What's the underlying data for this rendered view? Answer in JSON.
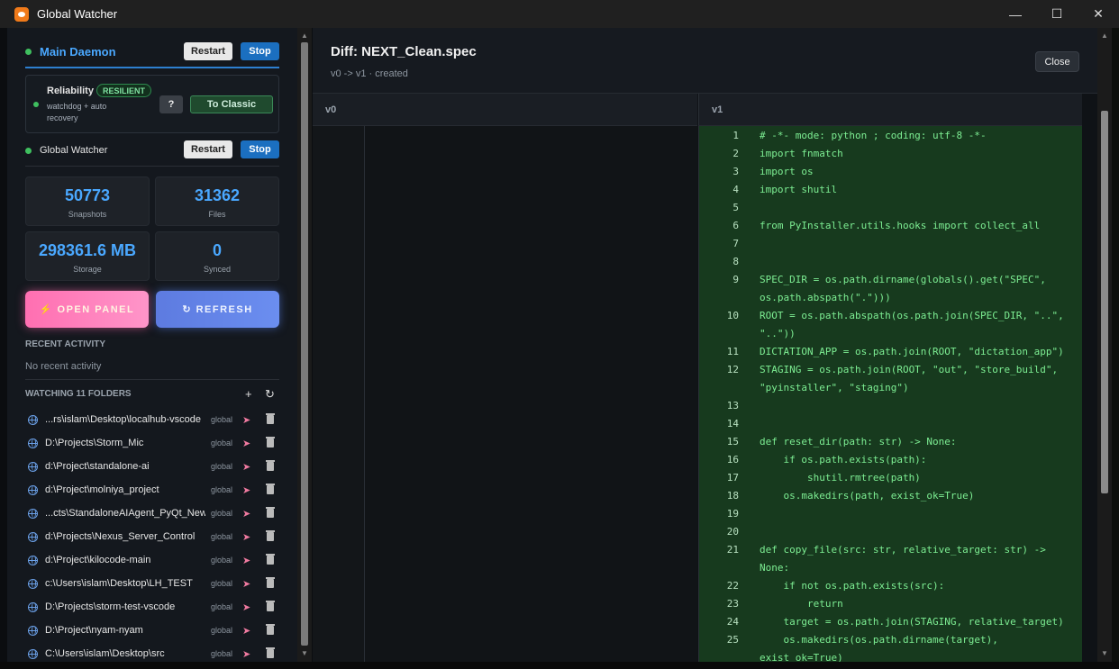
{
  "window": {
    "title": "Global Watcher"
  },
  "daemon": {
    "name": "Main Daemon",
    "restart_label": "Restart",
    "stop_label": "Stop"
  },
  "reliability": {
    "label": "Reliability",
    "badge": "RESILIENT",
    "desc": "watchdog + auto recovery",
    "help_label": "?",
    "classic_label": "To Classic"
  },
  "watcher": {
    "name": "Global Watcher",
    "restart_label": "Restart",
    "stop_label": "Stop"
  },
  "stats": [
    {
      "value": "50773",
      "label": "Snapshots"
    },
    {
      "value": "31362",
      "label": "Files"
    },
    {
      "value": "298361.6 MB",
      "label": "Storage"
    },
    {
      "value": "0",
      "label": "Synced"
    }
  ],
  "actions": {
    "open_panel": "⚡ OPEN PANEL",
    "refresh": "↻ REFRESH"
  },
  "recent": {
    "title": "RECENT ACTIVITY",
    "empty": "No recent activity"
  },
  "folders": {
    "title": "WATCHING 11 FOLDERS",
    "add_icon": "+",
    "refresh_icon": "↻",
    "items": [
      {
        "path": "...rs\\islam\\Desktop\\localhub-vscode",
        "scope": "global"
      },
      {
        "path": "D:\\Projects\\Storm_Mic",
        "scope": "global"
      },
      {
        "path": "d:\\Project\\standalone-ai",
        "scope": "global"
      },
      {
        "path": "d:\\Project\\molniya_project",
        "scope": "global"
      },
      {
        "path": "...cts\\StandaloneAIAgent_PyQt_New",
        "scope": "global"
      },
      {
        "path": "d:\\Projects\\Nexus_Server_Control",
        "scope": "global"
      },
      {
        "path": "d:\\Project\\kilocode-main",
        "scope": "global"
      },
      {
        "path": "c:\\Users\\islam\\Desktop\\LH_TEST",
        "scope": "global"
      },
      {
        "path": "D:\\Projects\\storm-test-vscode",
        "scope": "global"
      },
      {
        "path": "D:\\Project\\nyam-nyam",
        "scope": "global"
      },
      {
        "path": "C:\\Users\\islam\\Desktop\\src",
        "scope": "global"
      }
    ]
  },
  "diff": {
    "title": "Diff: NEXT_Clean.spec",
    "subtitle": "v0 -> v1 · created",
    "close_label": "Close",
    "left_header": "v0",
    "right_header": "v1",
    "lines": [
      {
        "n": "1",
        "text": "# -*- mode: python ; coding: utf-8 -*-"
      },
      {
        "n": "2",
        "text": "import fnmatch"
      },
      {
        "n": "3",
        "text": "import os"
      },
      {
        "n": "4",
        "text": "import shutil"
      },
      {
        "n": "5",
        "text": ""
      },
      {
        "n": "6",
        "text": "from PyInstaller.utils.hooks import collect_all"
      },
      {
        "n": "7",
        "text": ""
      },
      {
        "n": "8",
        "text": ""
      },
      {
        "n": "9",
        "text": "SPEC_DIR = os.path.dirname(globals().get(\"SPEC\","
      },
      {
        "n": "",
        "text": "os.path.abspath(\".\")))"
      },
      {
        "n": "10",
        "text": "ROOT = os.path.abspath(os.path.join(SPEC_DIR, \"..\","
      },
      {
        "n": "",
        "text": "\"..\"))"
      },
      {
        "n": "11",
        "text": "DICTATION_APP = os.path.join(ROOT, \"dictation_app\")"
      },
      {
        "n": "12",
        "text": "STAGING = os.path.join(ROOT, \"out\", \"store_build\","
      },
      {
        "n": "",
        "text": "\"pyinstaller\", \"staging\")"
      },
      {
        "n": "13",
        "text": ""
      },
      {
        "n": "14",
        "text": ""
      },
      {
        "n": "15",
        "text": "def reset_dir(path: str) -> None:"
      },
      {
        "n": "16",
        "text": "    if os.path.exists(path):"
      },
      {
        "n": "17",
        "text": "        shutil.rmtree(path)"
      },
      {
        "n": "18",
        "text": "    os.makedirs(path, exist_ok=True)"
      },
      {
        "n": "19",
        "text": ""
      },
      {
        "n": "20",
        "text": ""
      },
      {
        "n": "21",
        "text": "def copy_file(src: str, relative_target: str) ->"
      },
      {
        "n": "",
        "text": "None:"
      },
      {
        "n": "22",
        "text": "    if not os.path.exists(src):"
      },
      {
        "n": "23",
        "text": "        return"
      },
      {
        "n": "24",
        "text": "    target = os.path.join(STAGING, relative_target)"
      },
      {
        "n": "25",
        "text": "    os.makedirs(os.path.dirname(target),"
      },
      {
        "n": "",
        "text": "exist_ok=True)"
      }
    ]
  }
}
